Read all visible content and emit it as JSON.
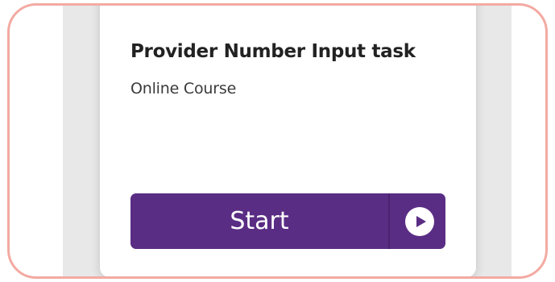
{
  "course": {
    "title": "Provider Number Input task",
    "subtitle": "Online Course"
  },
  "action": {
    "start_label": "Start",
    "icon": "play-circle-icon"
  },
  "colors": {
    "highlight_border": "#f3aaa2",
    "button_bg": "#5a2d84",
    "button_divider": "#4a2270",
    "background_panel": "#e8e8e8"
  }
}
